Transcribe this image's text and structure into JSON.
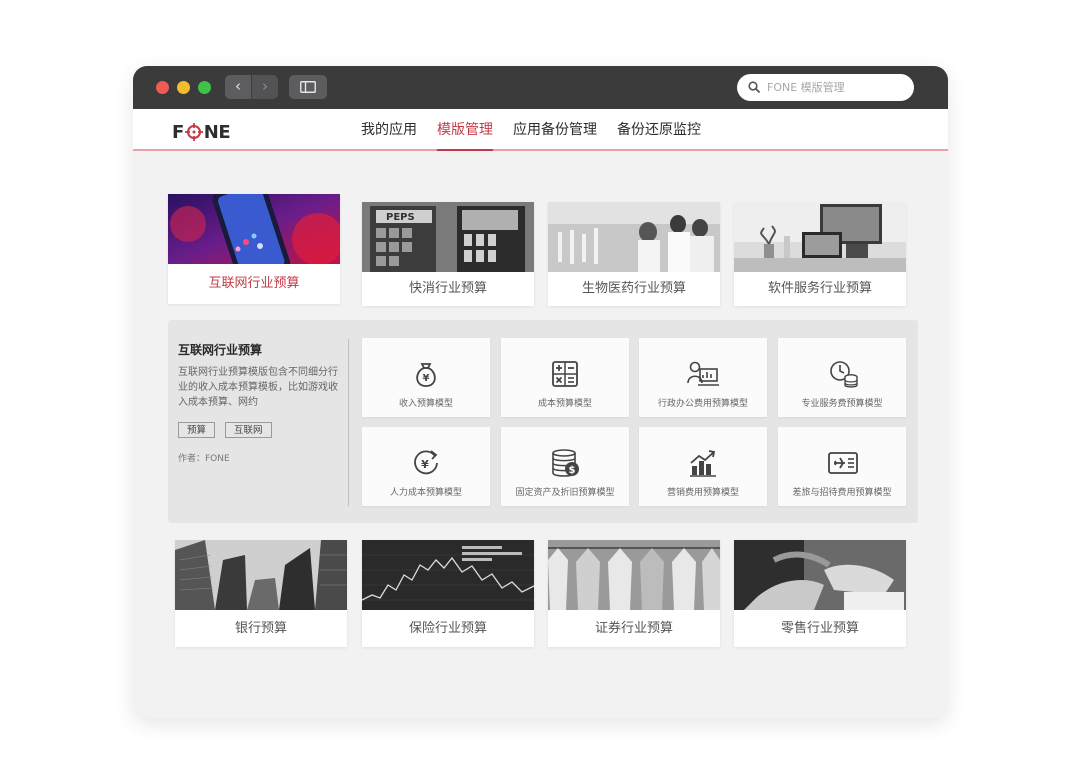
{
  "browser": {
    "search_placeholder": "FONE 模版管理"
  },
  "header": {
    "logo_left": "F",
    "logo_right": "NE",
    "tabs": [
      {
        "label": "我的应用"
      },
      {
        "label": "模版管理",
        "active": true
      },
      {
        "label": "应用备份管理"
      },
      {
        "label": "备份还原监控"
      }
    ]
  },
  "colors": {
    "accent": "#c43a47",
    "titlebar": "#3b3b3c",
    "background": "#f3f2f3"
  },
  "top_cards": [
    {
      "label": "互联网行业预算",
      "active": true
    },
    {
      "label": "快消行业预算"
    },
    {
      "label": "生物医药行业预算"
    },
    {
      "label": "软件服务行业预算"
    }
  ],
  "detail": {
    "title": "互联网行业预算",
    "description": "互联网行业预算模版包含不同细分行业的收入成本预算模板，比如游戏收入成本预算、网约",
    "tags": [
      "预算",
      "互联网"
    ],
    "author": "作者：FONE",
    "models": [
      {
        "label": "收入预算模型",
        "icon": "money-bag-yen-icon"
      },
      {
        "label": "成本预算模型",
        "icon": "calculator-icon"
      },
      {
        "label": "行政办公费用预算模型",
        "icon": "office-user-monitor-icon"
      },
      {
        "label": "专业服务费预算模型",
        "icon": "clock-coins-icon"
      },
      {
        "label": "人力成本预算模型",
        "icon": "yen-refresh-icon"
      },
      {
        "label": "固定资产及折旧预算模型",
        "icon": "coin-stack-dollar-icon"
      },
      {
        "label": "营销费用预算模型",
        "icon": "bar-chart-up-icon"
      },
      {
        "label": "差旅与招待费用预算模型",
        "icon": "flight-ticket-icon"
      }
    ]
  },
  "bottom_cards": [
    {
      "label": "银行预算"
    },
    {
      "label": "保险行业预算"
    },
    {
      "label": "证券行业预算"
    },
    {
      "label": "零售行业预算"
    }
  ]
}
